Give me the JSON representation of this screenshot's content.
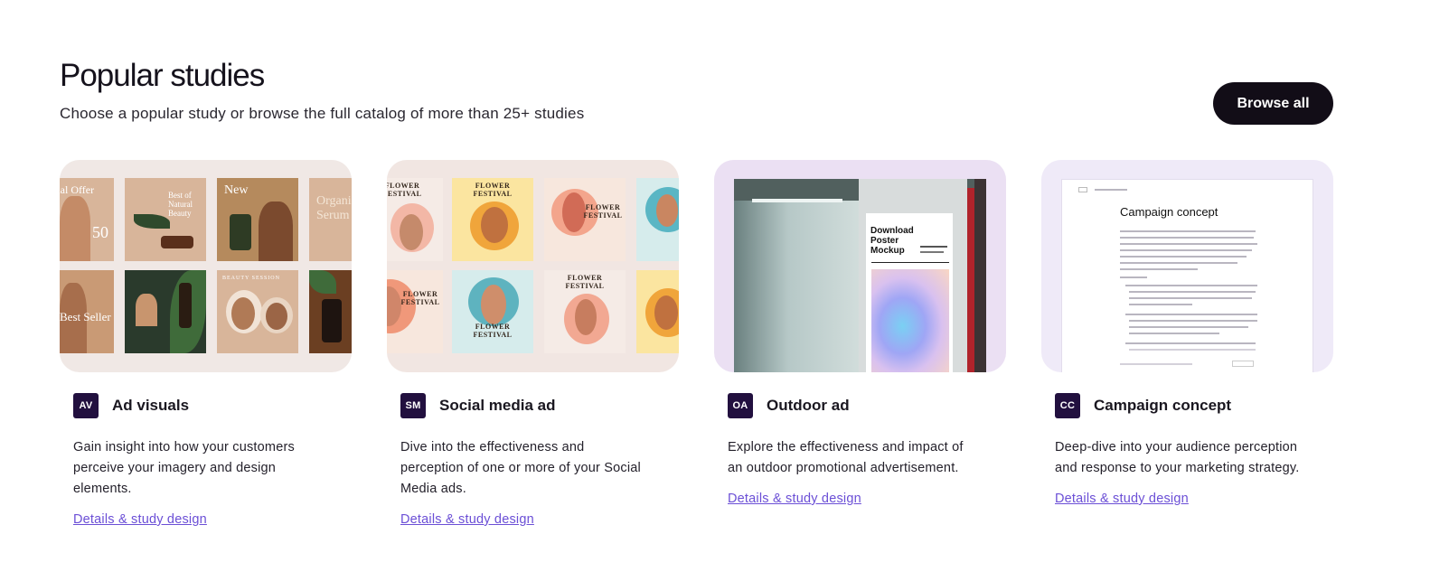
{
  "header": {
    "title": "Popular studies",
    "subtitle": "Choose a popular study or browse the full catalog of more than 25+ studies",
    "browse_label": "Browse all"
  },
  "colors": {
    "badge": "#22103f",
    "button": "#120d17",
    "link": "#6b4fd6"
  },
  "cards": [
    {
      "badge": "AV",
      "title": "Ad visuals",
      "description": "Gain insight into how your customers perceive your imagery and design elements.",
      "link": "Details & study design",
      "thumb_text": {
        "offer": "Special Offer",
        "fifty": "50",
        "natural": "Best of Natural Beauty",
        "new": "New",
        "organic": "Organic Serum",
        "seller": "Best Seller",
        "beauty": "BEAUTY SESSION"
      }
    },
    {
      "badge": "SM",
      "title": "Social media ad",
      "description": "Dive into the effectiveness and perception of one or more of your Social Media ads.",
      "link": "Details & study design",
      "thumb_text": {
        "flower": "FLOWER",
        "festival": "FESTIVAL"
      }
    },
    {
      "badge": "OA",
      "title": "Outdoor ad",
      "description": "Explore the effectiveness and impact of an outdoor promotional advertisement.",
      "link": "Details & study design",
      "thumb_text": {
        "poster_title": "Download Poster Mockup"
      }
    },
    {
      "badge": "CC",
      "title": "Campaign concept",
      "description": "Deep-dive into your audience perception and response to your marketing strategy.",
      "link": "Details & study design",
      "thumb_text": {
        "doc_title": "Campaign concept"
      }
    }
  ]
}
